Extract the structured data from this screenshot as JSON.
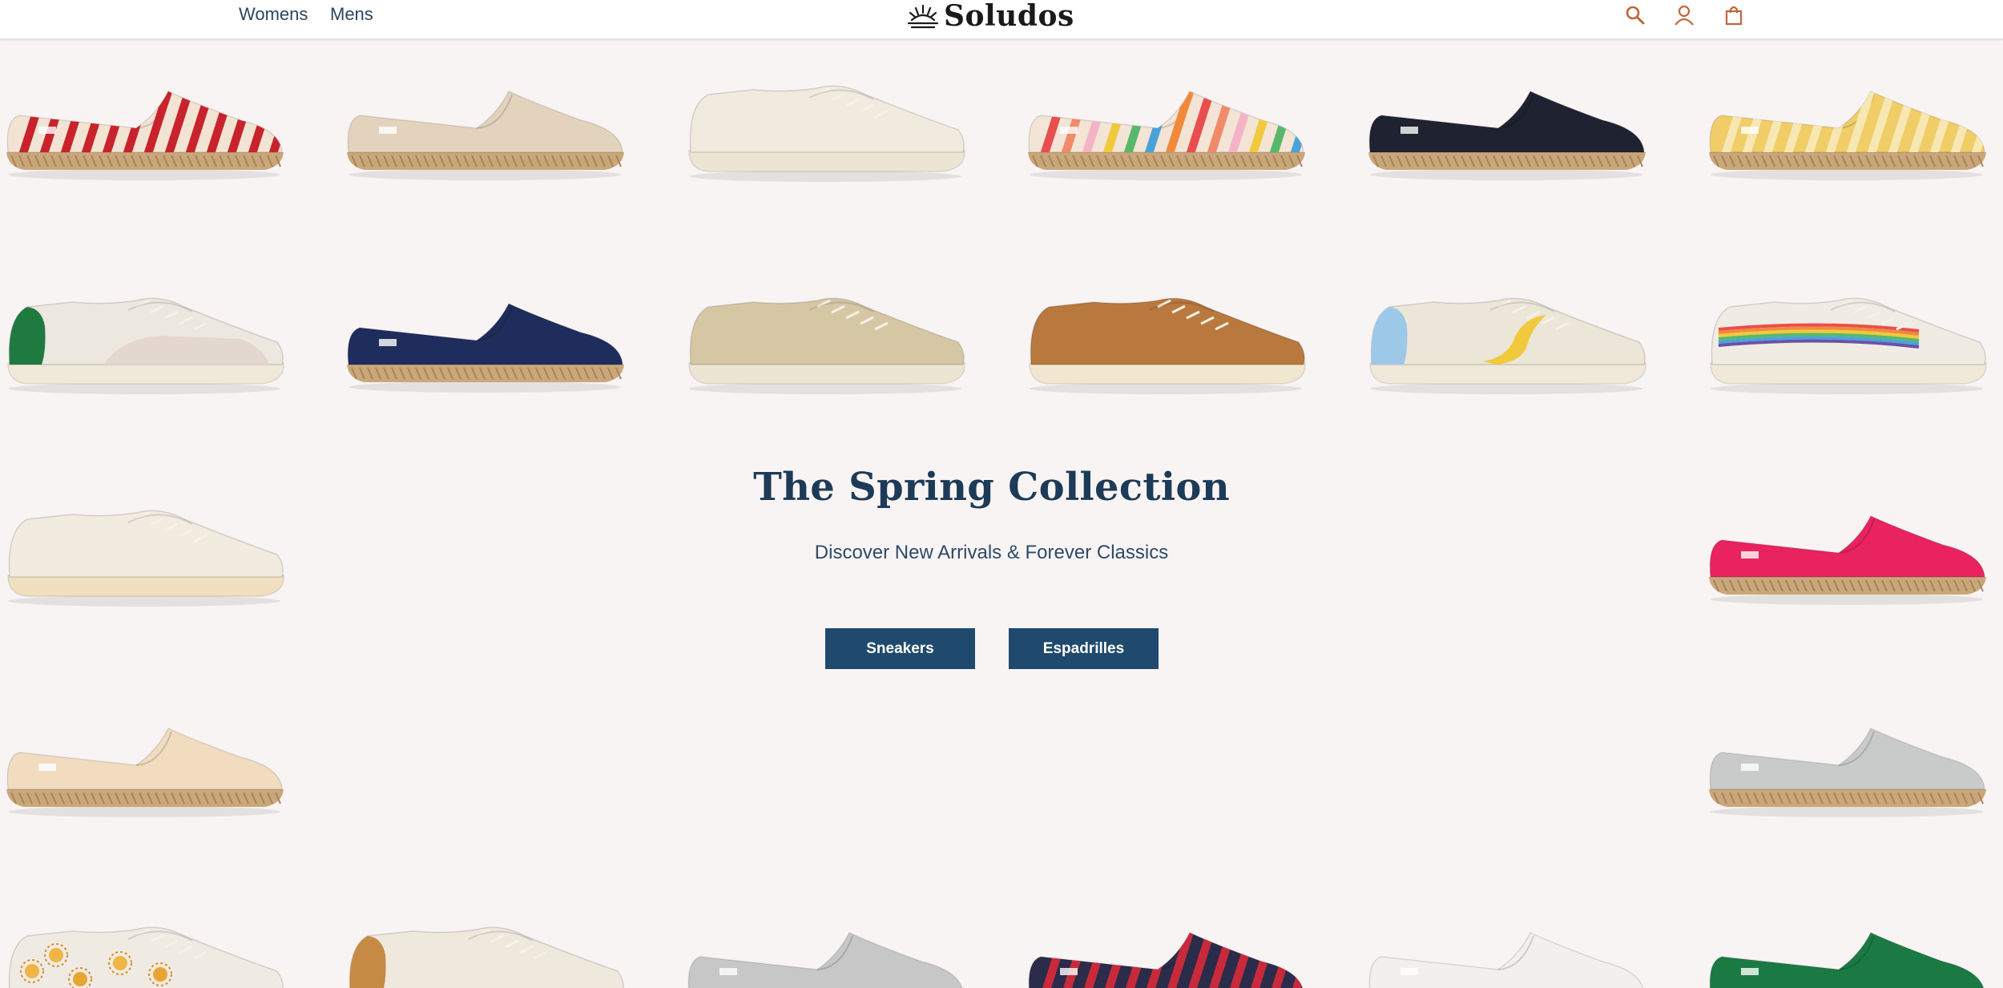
{
  "header": {
    "nav": [
      {
        "label": "Womens"
      },
      {
        "label": "Mens"
      }
    ],
    "logo_text": "Soludos",
    "icons": [
      "search-icon",
      "account-icon",
      "cart-icon"
    ],
    "accent_color": "#c0663a"
  },
  "hero": {
    "title": "The Spring Collection",
    "subtitle": "Discover New Arrivals & Forever Classics",
    "buttons": [
      {
        "label": "Sneakers"
      },
      {
        "label": "Espadrilles"
      }
    ],
    "button_color": "#1f4a6e",
    "title_color": "#1d3b58"
  },
  "products": [
    {
      "style": "espadrille",
      "upper": "#f2e3d3",
      "pattern": "stripes",
      "stripe": "#c8232c"
    },
    {
      "style": "espadrille",
      "upper": "#e3d3bd",
      "pattern": "solid"
    },
    {
      "style": "sneaker",
      "upper": "#f1ebdf",
      "sole": "#ede5d4"
    },
    {
      "style": "espadrille",
      "upper": "#f3e4d6",
      "pattern": "rainbow-stripes"
    },
    {
      "style": "espadrille",
      "upper": "#1f2230",
      "pattern": "solid"
    },
    {
      "style": "espadrille",
      "upper": "#f0cd67",
      "pattern": "stripes",
      "stripe": "#f7e7b3"
    },
    {
      "style": "sneaker",
      "upper": "#ece7df",
      "accent": "#1f7a42",
      "panel": "#e2d5cd"
    },
    {
      "style": "espadrille",
      "upper": "#1e2d5c",
      "pattern": "solid"
    },
    {
      "style": "sneaker",
      "upper": "#d6c7a4",
      "sole": "#ede5d4"
    },
    {
      "style": "sneaker",
      "upper": "#b8783e",
      "sole": "#f1e6cf"
    },
    {
      "style": "sneaker",
      "upper": "#ece6d8",
      "accent": "#9ec8e8",
      "swoosh": "#f1c93c"
    },
    {
      "style": "sneaker",
      "upper": "#f1ece3",
      "pattern": "rainbow-band"
    },
    {
      "style": "sneaker",
      "upper": "#f1ebe0",
      "sole": "#f0dfc0"
    },
    {
      "style": "espadrille",
      "upper": "#e8235f",
      "pattern": "solid"
    },
    {
      "style": "espadrille",
      "upper": "#f2dcc0",
      "pattern": "solid"
    },
    {
      "style": "espadrille",
      "upper": "#c9cbcb",
      "pattern": "solid"
    },
    {
      "style": "sneaker",
      "upper": "#f0ebe2",
      "pattern": "suns"
    },
    {
      "style": "sneaker",
      "upper": "#efe8dd",
      "accent": "#c58a44"
    },
    {
      "style": "espadrille",
      "upper": "#c7c7c7",
      "pattern": "solid"
    },
    {
      "style": "espadrille",
      "upper": "#2a2c4a",
      "pattern": "stripes",
      "stripe": "#c92a3a"
    },
    {
      "style": "espadrille",
      "upper": "#f1f0ee",
      "pattern": "solid"
    },
    {
      "style": "espadrille",
      "upper": "#1b7a44",
      "pattern": "solid"
    }
  ]
}
